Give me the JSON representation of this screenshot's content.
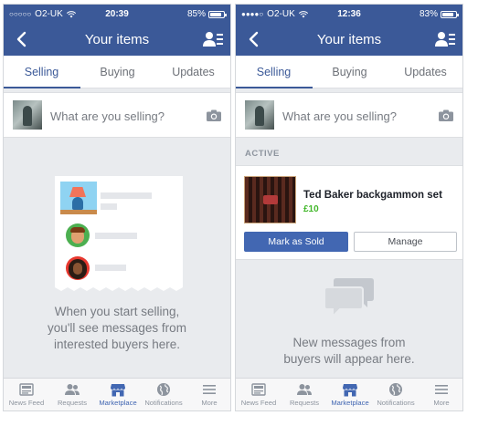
{
  "screens": [
    {
      "status": {
        "carrier": "O2-UK",
        "time": "20:39",
        "battery": "85%",
        "battery_level": 0.85
      },
      "nav": {
        "title": "Your items"
      },
      "tabs": [
        "Selling",
        "Buying",
        "Updates"
      ],
      "active_tab": "Selling",
      "composer": {
        "placeholder": "What are you selling?"
      },
      "empty_state": {
        "lines": [
          "When you start selling,",
          "you'll see messages from",
          "interested buyers here."
        ]
      },
      "bottom_tabs": [
        {
          "label": "News Feed",
          "icon": "news-feed-icon"
        },
        {
          "label": "Requests",
          "icon": "requests-icon"
        },
        {
          "label": "Marketplace",
          "icon": "marketplace-icon"
        },
        {
          "label": "Notifications",
          "icon": "globe-icon"
        },
        {
          "label": "More",
          "icon": "menu-icon"
        }
      ],
      "active_bottom_tab": "Marketplace"
    },
    {
      "status": {
        "carrier": "O2-UK",
        "time": "12:36",
        "battery": "83%",
        "battery_level": 0.83
      },
      "nav": {
        "title": "Your items"
      },
      "tabs": [
        "Selling",
        "Buying",
        "Updates"
      ],
      "active_tab": "Selling",
      "composer": {
        "placeholder": "What are you selling?"
      },
      "section_header": "ACTIVE",
      "item": {
        "title": "Ted Baker backgammon set",
        "price": "£10",
        "primary_action": "Mark as Sold",
        "secondary_action": "Manage"
      },
      "empty_state": {
        "lines": [
          "New messages from",
          "buyers will appear here."
        ]
      },
      "bottom_tabs": [
        {
          "label": "News Feed",
          "icon": "news-feed-icon"
        },
        {
          "label": "Requests",
          "icon": "requests-icon"
        },
        {
          "label": "Marketplace",
          "icon": "marketplace-icon"
        },
        {
          "label": "Notifications",
          "icon": "globe-icon"
        },
        {
          "label": "More",
          "icon": "menu-icon"
        }
      ],
      "active_bottom_tab": "Marketplace"
    }
  ],
  "colors": {
    "brand": "#3b5998",
    "button": "#4267b2",
    "price": "#42b72a",
    "background": "#e9ebee"
  }
}
